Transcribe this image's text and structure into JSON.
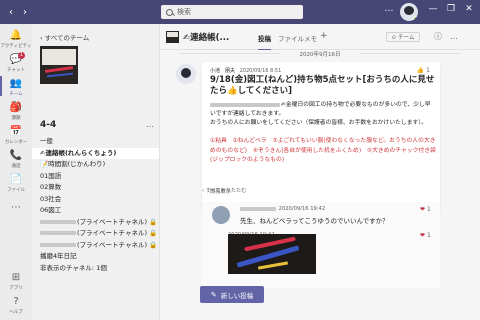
{
  "titlebar": {
    "search_placeholder": "検索",
    "back": "‹",
    "forward": "›",
    "more": "…",
    "minimize": "—",
    "maximize": "❐",
    "close": "✕"
  },
  "rail": [
    {
      "label": "アクティビティ",
      "icon": "bell-icon",
      "glyph": "🔔"
    },
    {
      "label": "チャット",
      "icon": "chat-icon",
      "glyph": "💬",
      "badge": "1"
    },
    {
      "label": "チーム",
      "icon": "teams-icon",
      "glyph": "👥",
      "active": true
    },
    {
      "label": "課題",
      "icon": "assignments-icon",
      "glyph": "🎒"
    },
    {
      "label": "カレンダー",
      "icon": "calendar-icon",
      "glyph": "📅"
    },
    {
      "label": "通話",
      "icon": "phone-icon",
      "glyph": "📞"
    },
    {
      "label": "ファイル",
      "icon": "files-icon",
      "glyph": "📄"
    },
    {
      "label": "…",
      "icon": "more-icon",
      "glyph": "⋯"
    },
    {
      "label": "アプリ",
      "icon": "apps-icon",
      "glyph": "⊞"
    },
    {
      "label": "ヘルプ",
      "icon": "help-icon",
      "glyph": "?"
    }
  ],
  "panel": {
    "back_label": "‹  すべてのチーム",
    "team_name": "4-4",
    "more": "…",
    "channels": [
      {
        "label": "一般"
      },
      {
        "label": "✍連絡帳(れんらくちょう)",
        "active": true
      },
      {
        "label": "📝時間割(じかんわり)"
      },
      {
        "label": "01国語"
      },
      {
        "label": "02算数"
      },
      {
        "label": "03社会"
      },
      {
        "label": "06図工"
      },
      {
        "label": "(プライベートチャネル) 🔒",
        "blurred": true
      },
      {
        "label": "(プライベートチャネル) 🔒",
        "blurred": true
      },
      {
        "label": "(プライベートチャネル) 🔒",
        "blurred": true
      },
      {
        "label": "播磨4年日記"
      },
      {
        "label": "非表示のチャネル: 1個"
      }
    ]
  },
  "header": {
    "title": "✍連絡帳(...",
    "tabs": [
      {
        "label": "投稿",
        "active": true
      },
      {
        "label": "ファイル"
      },
      {
        "label": "メモ"
      },
      {
        "label": "+"
      }
    ],
    "team_button": "⊙ チーム",
    "info_icon": "ⓘ",
    "more": "…"
  },
  "conversation": {
    "date": "2020年9月16日",
    "post": {
      "author": "小池　朋夫",
      "timestamp": "2020/09/16 8:51",
      "likes": "👍 1",
      "title": "9/18(金)図工(ねんど)持ち物5点セット[おうちの人に見せたら👍してください]",
      "body_line1": "✍金曜日の図工の持ち物で必要なものが多いので、少し早いですが連絡しておきます。",
      "body_line2": "おうちの人にお願いをしてください（保護者の皆様、お手数をおかけいたします）。",
      "items": "①粘具　②ねんどベラ　③よごれてもいい服(使わなくなった服など。おうちの人の大きめのものなど)　④ぞうきん(各自が使用した机をふくため)　⑤大きめのチャック付き袋(ジップロックのようなもの)",
      "see_more": "簡易表示"
    },
    "collapse": "‹ すべておりたたむ",
    "reply1": {
      "timestamp": "2020/09/16 19:42",
      "text": "先生、ねんどベラってこうゆうのでいいんですか？",
      "heart": "❤",
      "count": "1"
    },
    "reply2": {
      "timestamp": "2020/09/16 19:42",
      "heart": "❤",
      "count": "1"
    },
    "new_post": "新しい投稿",
    "new_post_icon": "✎"
  }
}
